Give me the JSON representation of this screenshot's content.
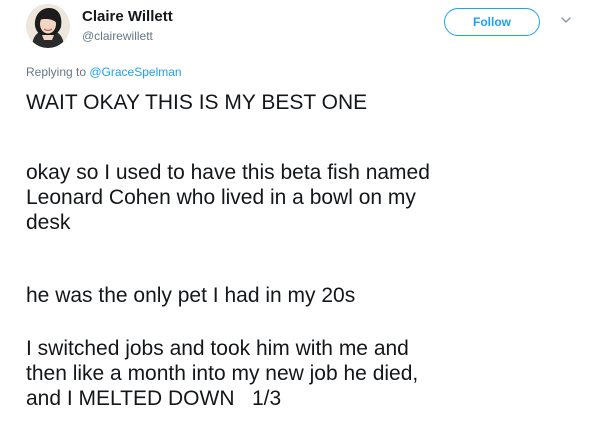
{
  "author": {
    "display_name": "Claire Willett",
    "handle": "@clairewillett",
    "avatar_icon": "profile-photo"
  },
  "follow_button": {
    "label": "Follow"
  },
  "reply_context": {
    "prefix": "Replying to ",
    "mention": "@GraceSpelman"
  },
  "tweet": {
    "paragraphs": [
      "WAIT OKAY THIS IS MY BEST ONE",
      "okay so I used to have this beta fish named\nLeonard Cohen who lived in a bowl on my\ndesk",
      "he was the only pet I had in my 20s",
      "I switched jobs and took him with me and\nthen like a month into my new job he died,\nand I MELTED DOWN   1/3"
    ]
  },
  "colors": {
    "accent": "#1da1f2",
    "text": "#14171a",
    "secondary": "#657786"
  }
}
